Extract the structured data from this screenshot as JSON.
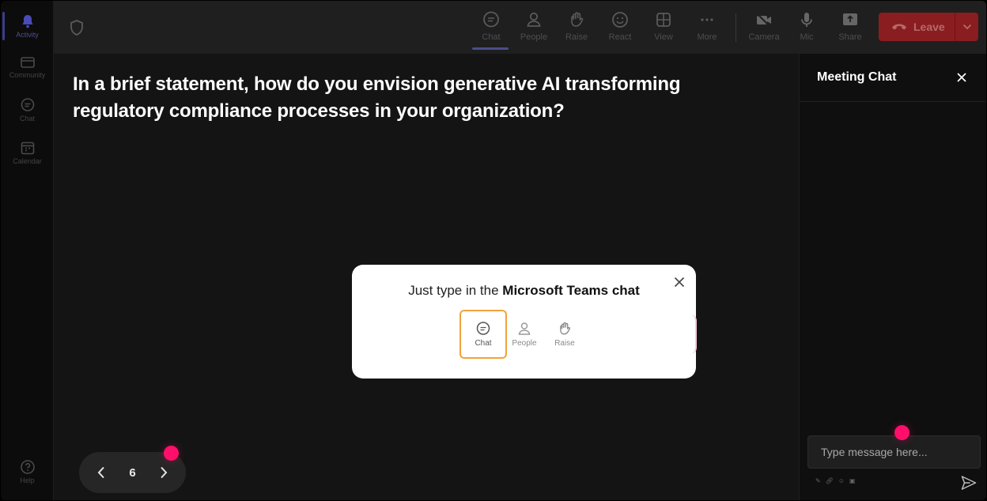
{
  "rail": {
    "items": [
      {
        "label": "Activity",
        "icon": "bell-icon"
      },
      {
        "label": "Community",
        "icon": "community-icon"
      },
      {
        "label": "Chat",
        "icon": "chat-icon"
      },
      {
        "label": "Calendar",
        "icon": "calendar-icon"
      }
    ],
    "help": {
      "label": "Help",
      "icon": "help-icon"
    }
  },
  "toolbar": {
    "buttons": [
      {
        "label": "Chat",
        "icon": "chat-icon"
      },
      {
        "label": "People",
        "icon": "people-icon"
      },
      {
        "label": "Raise",
        "icon": "hand-icon"
      },
      {
        "label": "React",
        "icon": "smiley-icon"
      },
      {
        "label": "View",
        "icon": "grid-icon"
      },
      {
        "label": "More",
        "icon": "more-icon"
      },
      {
        "label": "Camera",
        "icon": "camera-off-icon"
      },
      {
        "label": "Mic",
        "icon": "mic-icon"
      },
      {
        "label": "Share",
        "icon": "share-icon"
      }
    ],
    "leave_label": "Leave"
  },
  "stage": {
    "question": "In a brief statement, how do you envision generative AI transforming regulatory compliance processes in your organization?"
  },
  "pager": {
    "current_page": "6"
  },
  "chat_panel": {
    "title": "Meeting Chat",
    "input_placeholder": "Type message here..."
  },
  "popup": {
    "text_prefix": "Just type in the ",
    "text_bold": "Microsoft Teams chat",
    "buttons": [
      {
        "label": "Chat"
      },
      {
        "label": "People"
      },
      {
        "label": "Raise"
      }
    ]
  },
  "colors": {
    "accent": "#4c4d8c",
    "leave": "#8a1d1f",
    "highlight": "#f2a33a",
    "cursor_dot": "#ff0f6a"
  }
}
